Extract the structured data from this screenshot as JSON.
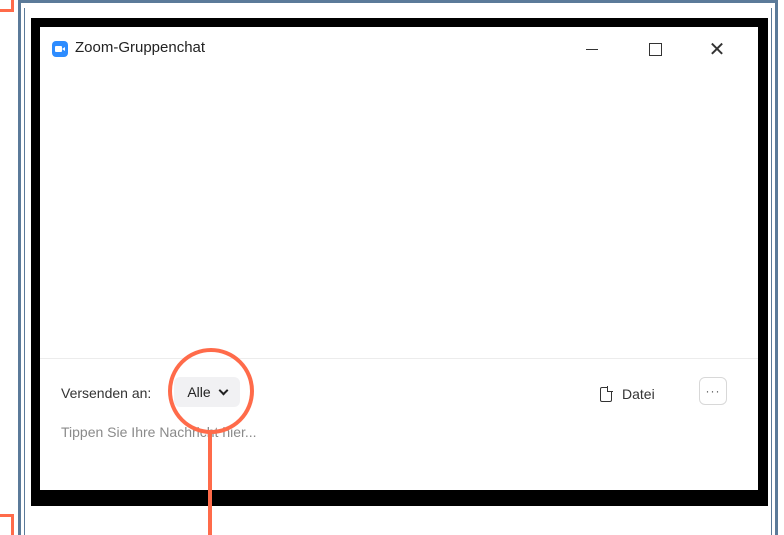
{
  "window": {
    "title": "Zoom-Gruppenchat",
    "controls": {
      "minimize": "minimize",
      "maximize": "maximize",
      "close": "✕"
    }
  },
  "compose": {
    "send_label": "Versenden an:",
    "recipient": "Alle",
    "file_label": "Datei",
    "more_label": "···",
    "input_placeholder": "Tippen Sie Ihre Nachricht hier...",
    "input_value": ""
  },
  "icons": {
    "app": "zoom-camera-icon",
    "file": "document-icon",
    "dropdown": "chevron-down-icon"
  },
  "colors": {
    "accent": "#2d8cff",
    "annotation": "#ff6b4a",
    "frame": "#5b7a99"
  }
}
